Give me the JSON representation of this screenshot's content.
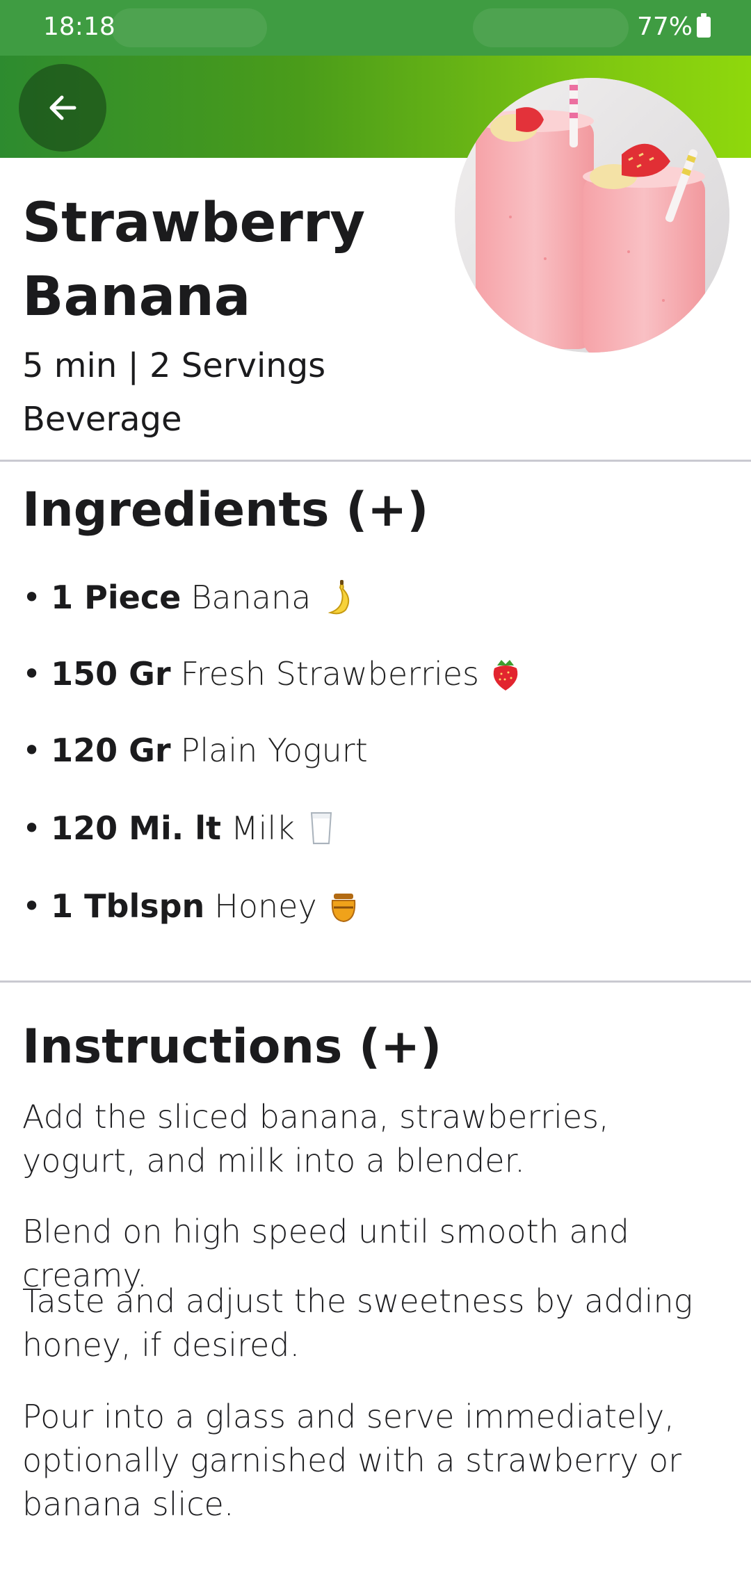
{
  "status_bar": {
    "time": "18:18",
    "battery": "77%"
  },
  "recipe": {
    "title_line1": "Strawberry",
    "title_line2": "Banana",
    "meta": "5 min | 2 Servings",
    "category": "Beverage"
  },
  "ingredients": {
    "title": "Ingredients (+)",
    "items": [
      {
        "bullet": "•",
        "qty": "1 Piece",
        "name": "Banana",
        "icon": "banana-icon"
      },
      {
        "bullet": "•",
        "qty": "150 Gr",
        "name": "Fresh Strawberries",
        "icon": "strawberry-icon"
      },
      {
        "bullet": "•",
        "qty": "120 Gr",
        "name": "Plain Yogurt",
        "icon": ""
      },
      {
        "bullet": "•",
        "qty": "120 Mi. lt",
        "name": "Milk",
        "icon": "milk-glass-icon"
      },
      {
        "bullet": "•",
        "qty": "1 Tblspn",
        "name": "Honey",
        "icon": "honey-pot-icon"
      }
    ]
  },
  "instructions": {
    "title": "Instructions (+)",
    "steps": [
      "Add the sliced banana, strawberries, yogurt, and milk into a blender.",
      "Blend on high speed until smooth and creamy.",
      "Taste and adjust the sweetness by adding honey, if desired.",
      "Pour into a glass and serve immediately, optionally garnished with a strawberry or banana slice."
    ]
  },
  "colors": {
    "status_bar": "#3f9c42",
    "header_start": "#2d8b2f",
    "header_end": "#8fd80c",
    "divider": "#c9c9d1",
    "text": "#1b1b1d"
  }
}
